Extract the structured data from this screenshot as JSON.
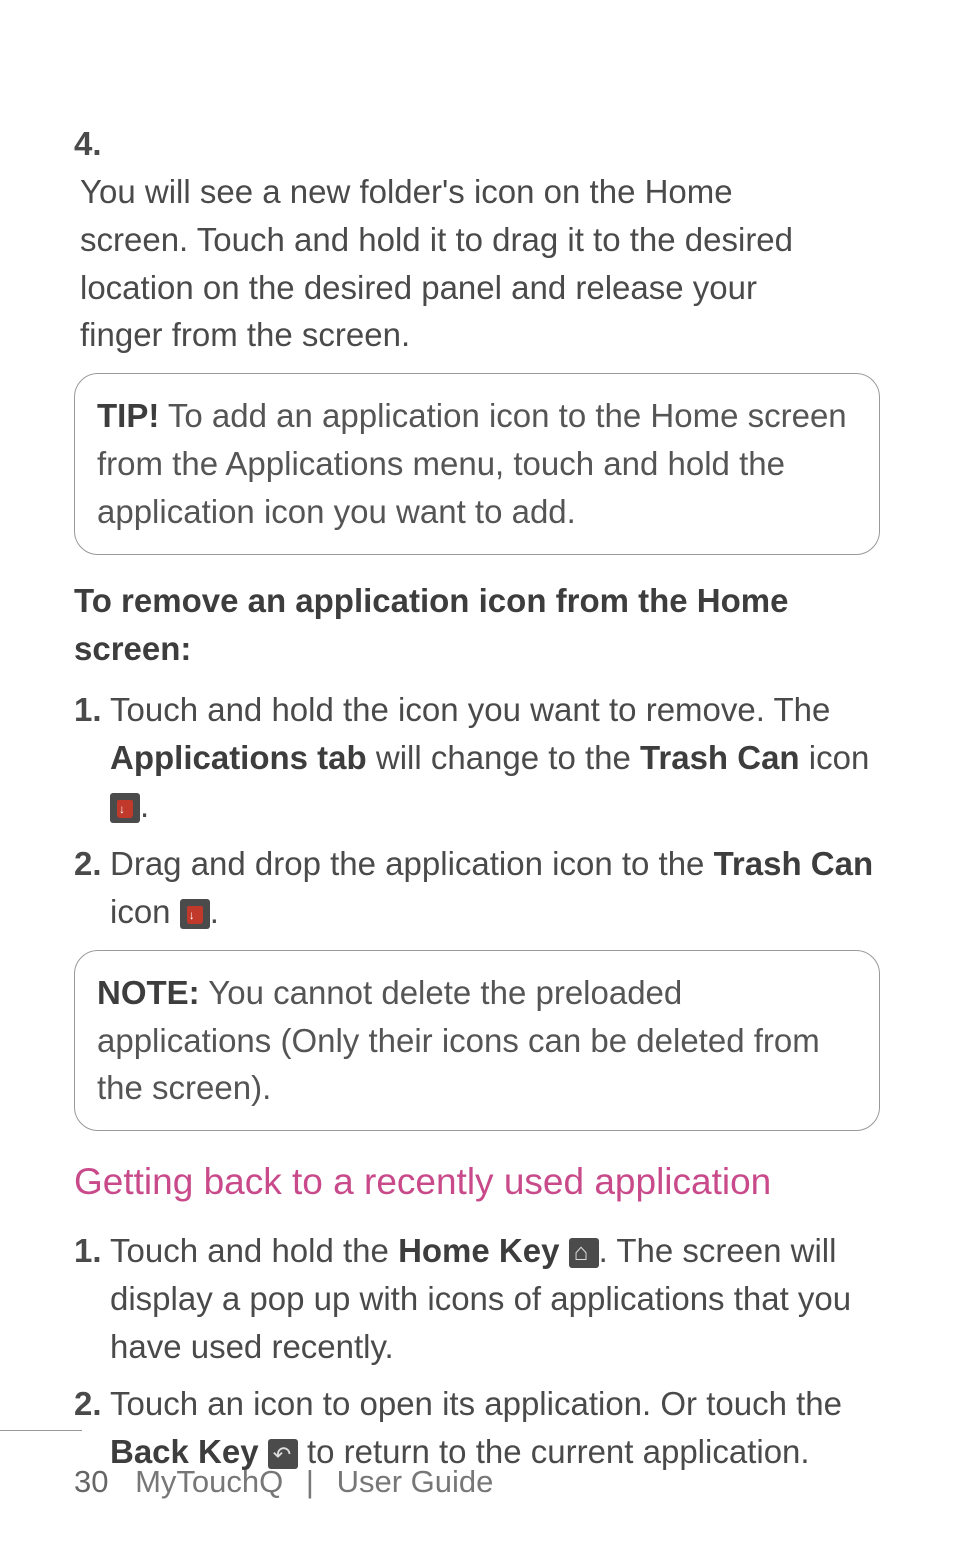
{
  "step4": {
    "num": "4.",
    "text": "You will see a new folder's icon on the Home screen. Touch and hold it to drag it to the desired location on the desired panel and release your finger from the screen."
  },
  "tip": {
    "label": "TIP!",
    "text": " To add an application icon to the Home screen from the Applications menu, touch and hold the application icon you want to add."
  },
  "subheading1": "To remove an application icon from the Home screen:",
  "remove": {
    "s1": {
      "num": "1.",
      "pre": " Touch and hold the icon you want to remove. The ",
      "b1": "Applications tab",
      "mid": " will change to the ",
      "b2": "Trash Can",
      "post": " icon ",
      "end": "."
    },
    "s2": {
      "num": "2.",
      "pre": "Drag and drop the application icon to the ",
      "b1": "Trash Can",
      "post": " icon ",
      "end": "."
    }
  },
  "note": {
    "label": "NOTE:",
    "text": " You cannot delete the preloaded applications (Only their icons can be deleted from the screen)."
  },
  "section_heading": "Getting back to a recently used application",
  "recent": {
    "s1": {
      "num": "1.",
      "pre": " Touch and hold the ",
      "b1": "Home Key",
      "mid": " ",
      "post": ". The screen will display a pop up with icons of applications that you have used recently."
    },
    "s2": {
      "num": "2.",
      "pre": "Touch an icon to open its application. Or touch the ",
      "b1": "Back Key",
      "mid": " ",
      "post": " to return to the current application."
    }
  },
  "footer": {
    "page": "30",
    "product": "MyTouchQ",
    "sep": "|",
    "guide": "User Guide"
  }
}
